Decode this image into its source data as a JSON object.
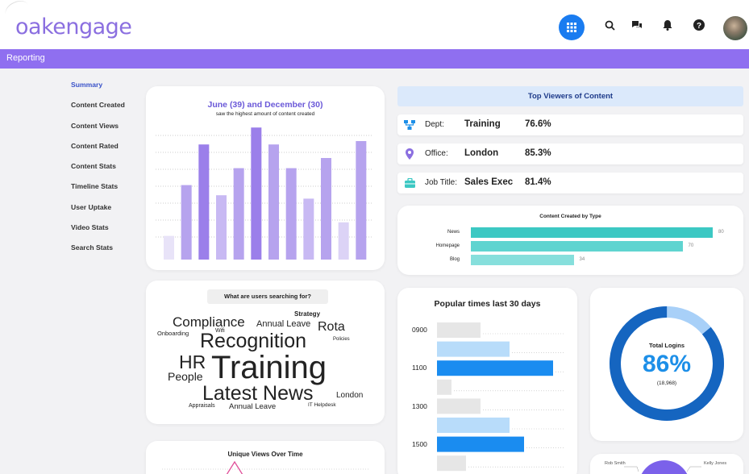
{
  "header": {
    "logo": "oakengage",
    "icons": [
      "apps-grid-icon",
      "search-icon",
      "chat-icon",
      "bell-icon",
      "help-icon"
    ]
  },
  "section_bar": {
    "title": "Reporting"
  },
  "sidenav": {
    "items": [
      {
        "label": "Summary",
        "active": true
      },
      {
        "label": "Content Created"
      },
      {
        "label": "Content Views"
      },
      {
        "label": "Content Rated"
      },
      {
        "label": "Content Stats"
      },
      {
        "label": "Timeline Stats"
      },
      {
        "label": "User Uptake"
      },
      {
        "label": "Video Stats"
      },
      {
        "label": "Search Stats"
      }
    ]
  },
  "content_created_chart": {
    "title": "June (39) and December (30)",
    "subtitle": "saw the highest amount of content created",
    "chart_data": {
      "type": "bar",
      "values": [
        7,
        22,
        34,
        19,
        27,
        39,
        34,
        27,
        18,
        30,
        11,
        35
      ],
      "ylim": [
        0,
        40
      ],
      "grid": true,
      "colors": [
        "#e8e3f8",
        "#b6a3ee",
        "#9b7fea",
        "#c8b9f3",
        "#b6a3ee",
        "#9b7fea",
        "#b6a3ee",
        "#b6a3ee",
        "#c8b9f3",
        "#b6a3ee",
        "#dcd3f6",
        "#b6a3ee"
      ]
    }
  },
  "top_viewers": {
    "title": "Top Viewers of Content",
    "rows": [
      {
        "icon": "org-chart-icon",
        "label": "Dept:",
        "value": "Training",
        "pct": "76.6%"
      },
      {
        "icon": "location-pin-icon",
        "label": "Office:",
        "value": "London",
        "pct": "85.3%"
      },
      {
        "icon": "briefcase-icon",
        "label": "Job Title:",
        "value": "Sales Exec",
        "pct": "81.4%"
      }
    ]
  },
  "content_by_type": {
    "title": "Content Created by Type",
    "chart_data": {
      "type": "bar",
      "orientation": "horizontal",
      "categories": [
        "News",
        "Homepage",
        "Blog"
      ],
      "values": [
        80,
        70,
        34
      ],
      "value_labels": [
        "80",
        "70",
        "34"
      ],
      "xlim": [
        0,
        80
      ],
      "colors": [
        "#3cc8c3",
        "#5fd4d0",
        "#86dfdc"
      ]
    }
  },
  "search_cloud": {
    "title": "What are users searching for?",
    "words": [
      {
        "text": "Strategy",
        "color": "#2f4fc4"
      },
      {
        "text": "Compliance",
        "color": "#8b6fe0"
      },
      {
        "text": "Annual Leave",
        "color": "#e0509a"
      },
      {
        "text": "Rota",
        "color": "#8b6fe0"
      },
      {
        "text": "Onboarding",
        "color": "#222222"
      },
      {
        "text": "Wifi",
        "color": "#222222"
      },
      {
        "text": "Recognition",
        "color": "#1d8fe8"
      },
      {
        "text": "Policies",
        "color": "#e0509a"
      },
      {
        "text": "HR",
        "color": "#8b6fe0"
      },
      {
        "text": "Training",
        "color": "#1f4fbf"
      },
      {
        "text": "People",
        "color": "#1d8fe8"
      },
      {
        "text": "Latest News",
        "color": "#e0509a"
      },
      {
        "text": "London",
        "color": "#222222"
      },
      {
        "text": "Appraisals",
        "color": "#2f4fc4"
      },
      {
        "text": "Annual Leave",
        "color": "#8b6fe0"
      },
      {
        "text": "IT Helpdesk",
        "color": "#2f4fc4"
      }
    ]
  },
  "popular_times": {
    "title": "Popular times last 30 days",
    "y_labels": [
      "0900",
      "1100",
      "1300",
      "1500"
    ],
    "chart_data": {
      "type": "bar",
      "orientation": "horizontal",
      "values": [
        3,
        5,
        8,
        1,
        3,
        5,
        6,
        2
      ],
      "xlim": [
        0,
        8
      ],
      "colors": [
        "#e6e6e6",
        "#b8dcfa",
        "#1a8cf0",
        "#e6e6e6",
        "#e6e6e6",
        "#b8dcfa",
        "#1a8cf0",
        "#e6e6e6"
      ]
    }
  },
  "total_logins": {
    "label": "Total Logins",
    "value": "86%",
    "count": "(18,968)",
    "fraction": 0.86,
    "colors": {
      "filled": "#1565c0",
      "remaining": "#a8d0f8"
    }
  },
  "unique_views": {
    "title": "Unique Views Over Time"
  },
  "bottom_right": {
    "labels": [
      "Rob Smith",
      "Kelly Jones"
    ]
  }
}
